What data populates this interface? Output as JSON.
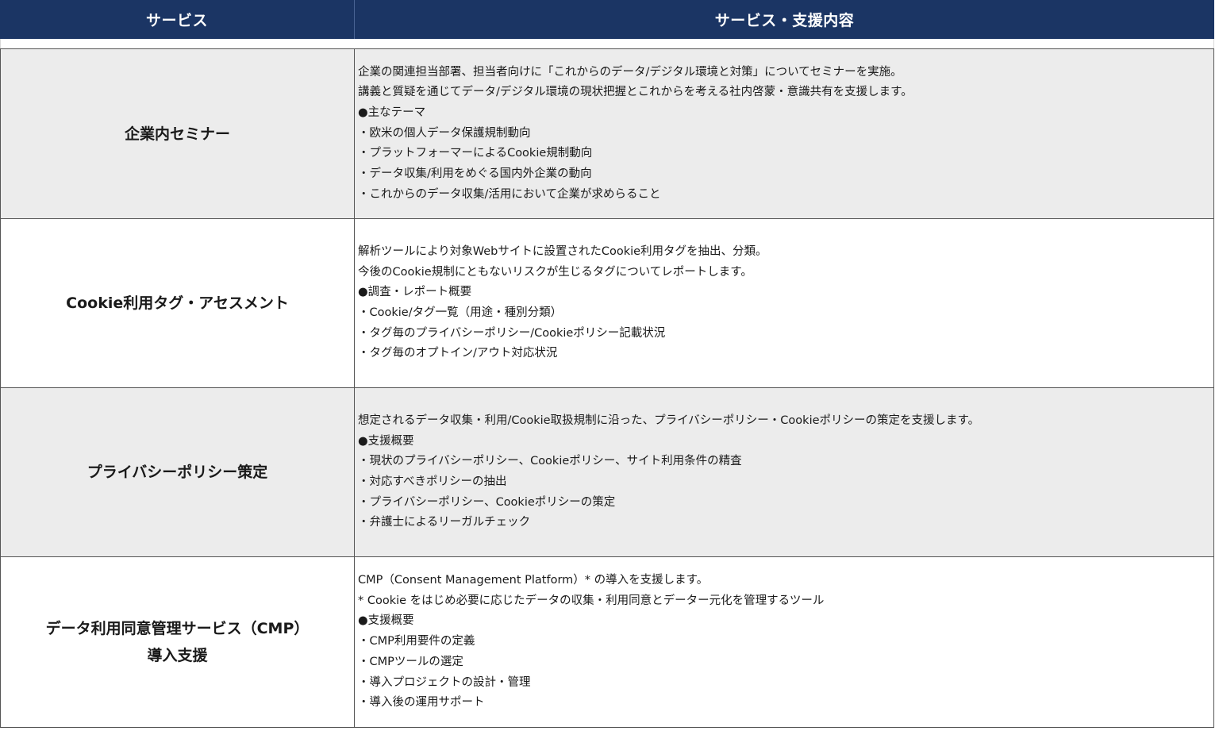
{
  "header": {
    "col_service": "サービス",
    "col_content": "サービス・支援内容"
  },
  "rows": [
    {
      "service_lines": [
        "企業内セミナー"
      ],
      "content_lines": [
        "企業の関連担当部署、担当者向けに「これからのデータ/デジタル環境と対策」についてセミナーを実施。",
        "講義と質疑を通じてデータ/デジタル環境の現状把握とこれからを考える社内啓蒙・意識共有を支援します。",
        "●主なテーマ",
        "・欧米の個人データ保護規制動向",
        "・プラットフォーマーによるCookie規制動向",
        "・データ収集/利用をめぐる国内外企業の動向",
        "・これからのデータ収集/活用において企業が求めらること"
      ]
    },
    {
      "service_lines": [
        "Cookie利用タグ・アセスメント"
      ],
      "content_lines": [
        "解析ツールにより対象Webサイトに設置されたCookie利用タグを抽出、分類。",
        "今後のCookie規制にともないリスクが生じるタグについてレポートします。",
        "●調査・レポート概要",
        "・Cookie/タグ一覧（用途・種別分類）",
        "・タグ毎のプライバシーポリシー/Cookieポリシー記載状況",
        "・タグ毎のオプトイン/アウト対応状況"
      ]
    },
    {
      "service_lines": [
        "プライバシーポリシー策定"
      ],
      "content_lines": [
        "想定されるデータ収集・利用/Cookie取扱規制に沿った、プライバシーポリシー・Cookieポリシーの策定を支援します。",
        "●支援概要",
        "・現状のプライバシーポリシー、Cookieポリシー、サイト利用条件の精査",
        "・対応すべきポリシーの抽出",
        "・プライバシーポリシー、Cookieポリシーの策定",
        "・弁護士によるリーガルチェック"
      ]
    },
    {
      "service_lines": [
        "データ利用同意管理サービス（CMP）",
        "導入支援"
      ],
      "content_lines": [
        "CMP（Consent Management Platform）* の導入を支援します。",
        "* Cookie をはじめ必要に応じたデータの収集・利用同意とデーター元化を管理するツール",
        "●支援概要",
        "・CMP利用要件の定義",
        "・CMPツールの選定",
        "・導入プロジェクトの設計・管理",
        "・導入後の運用サポート"
      ]
    }
  ],
  "colors": {
    "header_bg": "#1b3564",
    "header_text": "#ffffff",
    "row_shaded": "#ececec",
    "row_plain": "#ffffff",
    "border": "#555555"
  }
}
